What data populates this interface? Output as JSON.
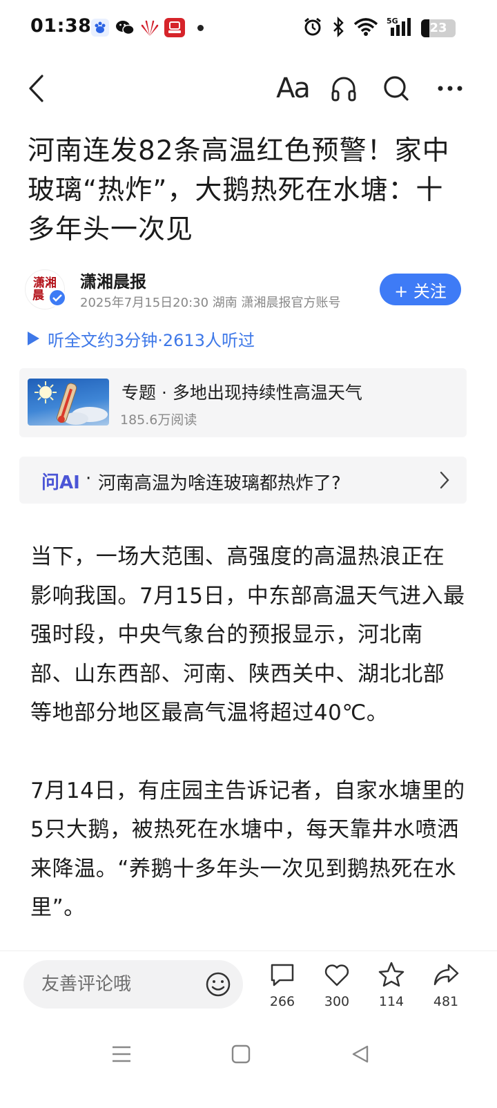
{
  "status_bar": {
    "time": "01:38",
    "battery_level": "23",
    "network": "5G",
    "icons": [
      "baidu-app-icon",
      "wechat-icon",
      "huawei-app-icon",
      "news-app-icon",
      "alarm-icon",
      "bluetooth-icon",
      "wifi-icon",
      "signal-icon",
      "battery-icon"
    ]
  },
  "top_nav": {
    "font_label": "Aa",
    "icons": [
      "back-arrow-icon",
      "headphones-icon",
      "search-icon",
      "more-icon"
    ]
  },
  "article": {
    "title": "河南连发82条高温红色预警！家中玻璃“热炸”，大鹅热死在水塘：十多年头一次见",
    "author": {
      "name": "潇湘晨报",
      "avatar_text_line1": "潇湘",
      "avatar_text_line2": "晨",
      "meta": "2025年7月15日20:30 湖南 潇湘晨报官方账号",
      "follow_label": "+ 关注"
    },
    "listen": {
      "label": "听全文约3分钟·2613人听过"
    },
    "topic": {
      "title": "专题 · 多地出现持续性高温天气",
      "reads": "185.6万阅读"
    },
    "ai": {
      "tag": "问AI",
      "separator": "·",
      "question": "河南高温为啥连玻璃都热炸了?"
    },
    "paragraphs": [
      "当下，一场大范围、高强度的高温热浪正在影响我国。7月15日，中东部高温天气进入最强时段，中央气象台的预报显示，河北南部、山东西部、河南、陕西关中、湖北北部等地部分地区最高气温将超过40℃。",
      "7月14日，有庄园主告诉记者，自家水塘里的5只大鹅，被热死在水塘中，每天靠井水喷洒来降温。“养鹅十多年头一次见到鹅热死在水里”。"
    ]
  },
  "bottom_bar": {
    "comment_placeholder": "友善评论哦",
    "comment_count": "266",
    "like_count": "300",
    "favorite_count": "114",
    "share_count": "481"
  },
  "colors": {
    "accent_blue": "#3e7bf6",
    "ai_purple": "#4b55d6",
    "card_bg": "#f5f5f6",
    "text_main": "#1c1c1c",
    "text_meta": "#888888"
  }
}
